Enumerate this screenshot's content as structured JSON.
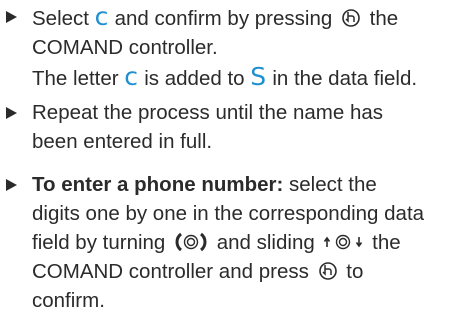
{
  "steps": [
    {
      "lines": [
        {
          "a": "Select ",
          "b": "c",
          "c": " and confirm by pressing ",
          "d": " the"
        },
        {
          "a": "COMAND controller."
        },
        {
          "a": "The letter ",
          "b": "c",
          "c": " is added to ",
          "d": "S",
          "e": " in the data field."
        }
      ]
    },
    {
      "lines": [
        {
          "a": "Repeat the process until the name has"
        },
        {
          "a": "been entered in full."
        }
      ]
    },
    {
      "bold": "To enter a phone number:",
      "lines": [
        {
          "a": " select the"
        },
        {
          "a": "digits one by one in the corresponding data"
        },
        {
          "a": "field by turning ",
          "b": " and sliding ",
          "c": " the"
        },
        {
          "a": "COMAND controller and press ",
          "b": " to"
        },
        {
          "a": "confirm."
        }
      ]
    }
  ],
  "icons": {
    "press": "controller-press-icon",
    "turn": "controller-turn-icon",
    "slide": "controller-slide-up-down-icon"
  },
  "colors": {
    "text": "#2b2b2b",
    "highlight": "#1e8fd0"
  }
}
